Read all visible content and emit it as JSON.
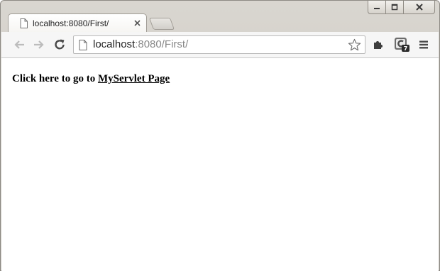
{
  "window": {
    "controls": [
      "minimize",
      "maximize",
      "close"
    ]
  },
  "tabs": [
    {
      "title": "localhost:8080/First/",
      "active": true,
      "icon": "page-icon"
    }
  ],
  "toolbar": {
    "url_host": "localhost",
    "url_rest": ":8080/First/",
    "icons": [
      "back-icon",
      "forward-icon",
      "reload-icon",
      "star-icon",
      "extension-puzzle-icon",
      "extension-c-icon",
      "menu-icon"
    ]
  },
  "content": {
    "prefix_text": "Click here to go to ",
    "link_text": "MyServlet Page"
  },
  "colors": {
    "frame": "#d9d6d0",
    "toolbar": "#f6f6f6",
    "url_dim": "#888888"
  }
}
